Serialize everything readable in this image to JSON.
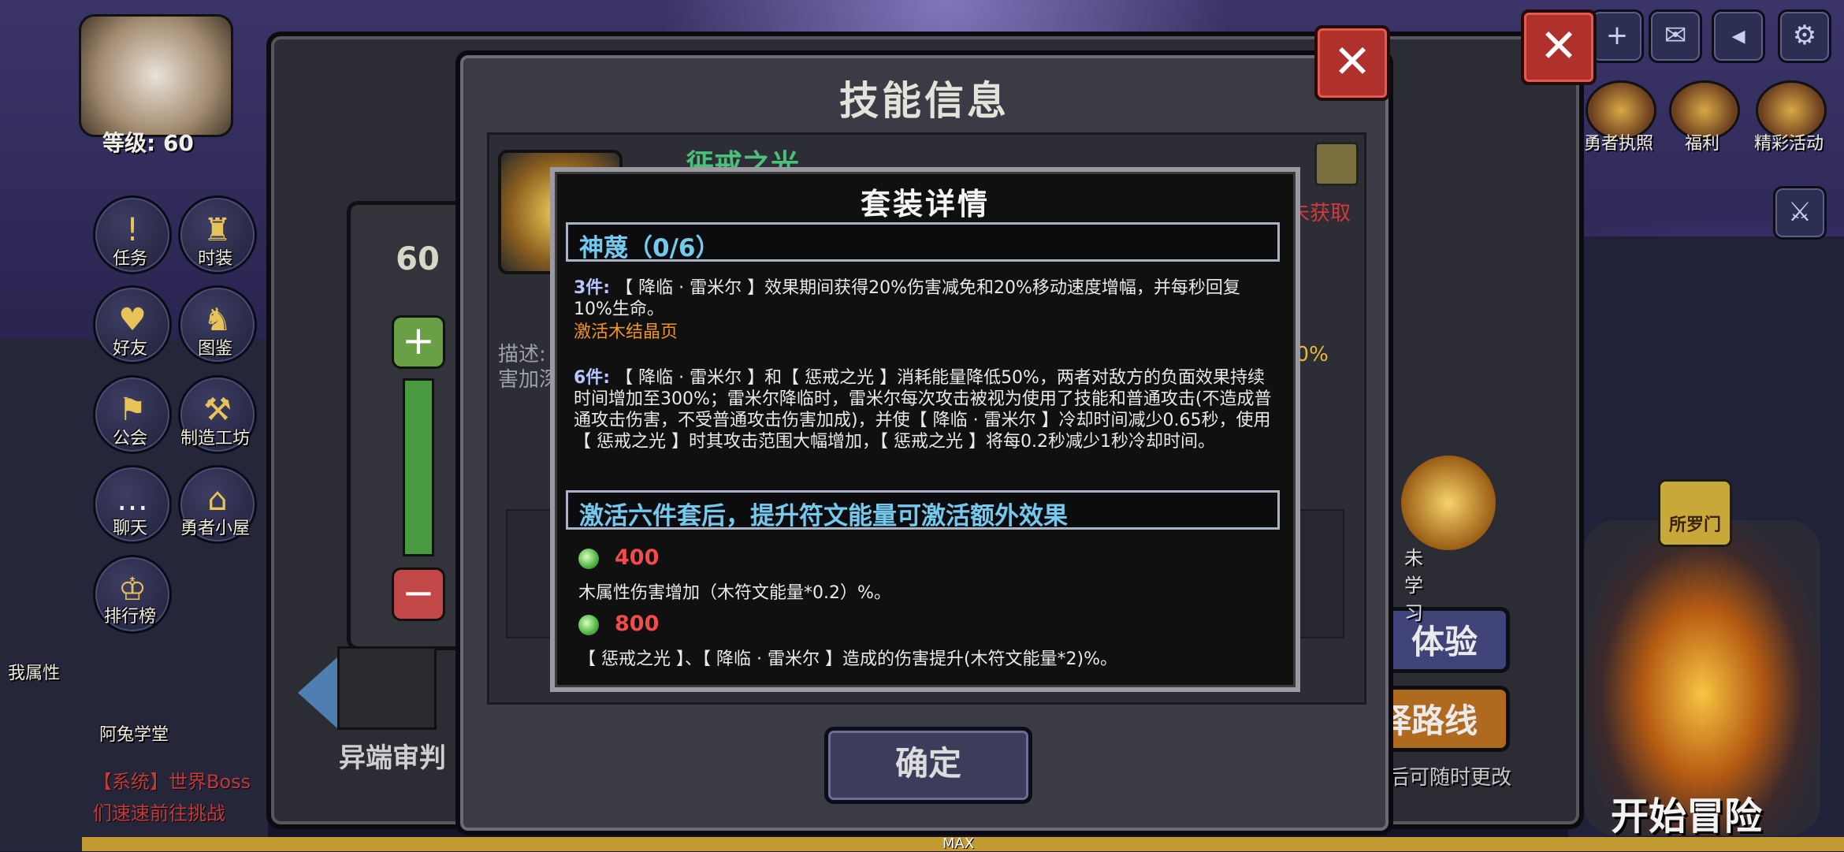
{
  "hud": {
    "level": "等级: 60",
    "buttons": [
      {
        "label": "任务",
        "icon": "quest-icon"
      },
      {
        "label": "时装",
        "icon": "outfit-icon"
      },
      {
        "label": "好友",
        "icon": "friends-icon"
      },
      {
        "label": "图鉴",
        "icon": "codex-icon"
      },
      {
        "label": "公会",
        "icon": "guild-icon"
      },
      {
        "label": "制造工坊",
        "icon": "workshop-icon"
      },
      {
        "label": "聊天",
        "icon": "chat-icon"
      },
      {
        "label": "勇者小屋",
        "icon": "cabin-icon"
      },
      {
        "label": "排行榜",
        "icon": "trophy-icon"
      }
    ],
    "chat_sender": "我属性",
    "academy": "阿兔学堂",
    "chat_lines": [
      "【系统】世界Boss",
      "们速速前往挑战"
    ]
  },
  "right_hud": {
    "top_icons": [
      "plus-icon",
      "mail-icon",
      "speaker-icon",
      "settings-icon"
    ],
    "features": [
      "勇者执照",
      "福利",
      "精彩活动"
    ],
    "portal_tag": "所罗门",
    "start": "开始冒险",
    "route_tip": "后可随时更改"
  },
  "skill_panel": {
    "title": "技能信息",
    "name": "惩戒之光",
    "status": "未获取",
    "level": "60",
    "desc_prefix": "描述:",
    "desc_pct": "20%",
    "desc_line2": "害加深",
    "learn_label": "未学习",
    "weapon_label": "异端审判",
    "btn_experience": "体验",
    "btn_route": "择路线",
    "confirm": "确定",
    "max_label": "MAX"
  },
  "popup": {
    "title": "套装详情",
    "set_name": "神蔑（0/6）",
    "bonus3_tag": "3件:",
    "bonus3_text": "【 降临 · 雷米尔 】效果期间获得20%伤害减免和20%移动速度增幅，并每秒回复10%生命。",
    "activate_hint": "激活木结晶页",
    "bonus6_tag": "6件:",
    "bonus6_text": "【 降临 · 雷米尔 】和【 惩戒之光 】消耗能量降低50%，两者对敌方的负面效果持续时间增加至300%；雷米尔降临时，雷米尔每次攻击被视为使用了技能和普通攻击(不造成普通攻击伤害，不受普通攻击伤害加成)，并使【 降临 · 雷米尔 】冷却时间减少0.65秒，使用【 惩戒之光 】时其攻击范围大幅增加，【 惩戒之光 】将每0.2秒减少1秒冷却时间。",
    "rune_header": "激活六件套后，提升符文能量可激活额外效果",
    "rune_tiers": [
      {
        "value": "400",
        "effect": "木属性伤害增加（木符文能量*0.2）%。"
      },
      {
        "value": "800",
        "effect": "【 惩戒之光 】、【 降临 · 雷米尔 】造成的伤害提升(木符文能量*2)%。"
      }
    ]
  },
  "colors": {
    "section_header_text": "#74c9ef",
    "activate_hint": "#f0941d",
    "rune_value": "#f24b4b",
    "close_button": "#b0302b"
  }
}
